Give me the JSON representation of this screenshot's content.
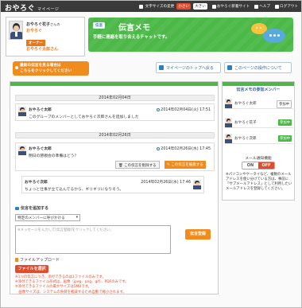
{
  "header": {
    "logo": "おやろぐ",
    "logo_sub": "マイページ",
    "font_size_label": "文字サイズの変更",
    "font_small": "小さい",
    "font_large": "大きい",
    "nav_info": "おやろぐ新着サイト",
    "nav_help": "ヘルプ",
    "nav_logout": "ログアウト"
  },
  "profile": {
    "name": "おやろぐ花子",
    "name_suffix": "さんの",
    "group": "おやろぐ",
    "role_badge": "オーナー",
    "group2": "おやろぐ太郎さん"
  },
  "banner": {
    "tag": "伝言",
    "title": "伝言メモ",
    "subtitle": "手軽に連絡を取り合えるチャットです。"
  },
  "actions": {
    "latest_line1": "最新の伝言を見る場合は",
    "latest_line2": "こちらをクリックしてください",
    "mypage_top": "マイページのトップへ戻る",
    "page_ops": "このページの操作について"
  },
  "thread": {
    "date1": "2014年02月04日",
    "msg1": {
      "author": "おやろぐ太郎",
      "time": "2014年02月04日(火) 17:51",
      "text": "このグループのメンバーとしておやろぐ次郎さんを追加しました"
    },
    "date2": "2014年02月26日",
    "msg2": {
      "author": "おやろぐ太郎",
      "time": "2014年02月26日(水) 17:45",
      "text": "明日の懇親会の準備はどう？",
      "delete_label": "この伝言を削除する",
      "edit_label": "この伝言を編集する"
    },
    "reply": {
      "author": "おやろぐ次郎",
      "time": "2014年02月26日(水) 17:46",
      "text": "ちょっと仕事が立て込んでるから、ギリギリになりそう。"
    }
  },
  "compose": {
    "title": "伝言を追加する",
    "recipient": "特定のメンバーに呼びかける",
    "placeholder": "※メッセージを入力して[伝言登録]をクリックしてください。",
    "send": "伝言登録",
    "file_title": "ファイルアップロード",
    "file_button": "ファイルを選択",
    "note1": "※1つの伝言につき、添付できるのは1ファイルのみです。",
    "note2": "※添付できるファイル形式は、画像（jpeg、png、gif）、PDFのみです。",
    "note3": "※添付できるファイルの最大サイズは5MBです。",
    "note4": "　画像サイズは、システムの負荷を軽減するため自動で縮小されます。"
  },
  "members": {
    "title": "伝言メモの参加メンバー",
    "list": [
      {
        "name": "おやろぐ太郎",
        "status": "参加中"
      },
      {
        "name": "おやろぐ花子",
        "status": "参加中"
      },
      {
        "name": "おやろぐ次郎",
        "status": "参加中"
      }
    ],
    "notify_title": "メール通知機能",
    "toggle_on": "ON",
    "toggle_off": "OFF",
    "note": "※パソコンやケータイなど、複数のメールアドレスを使い分けている方は、事前に「サブメールアドレス」として利用したいメールアドレスを登録してください。"
  },
  "colors": {
    "green": "#4cb848",
    "orange": "#f08c1d",
    "red": "#e34b2d",
    "blue": "#2d7fc1"
  }
}
